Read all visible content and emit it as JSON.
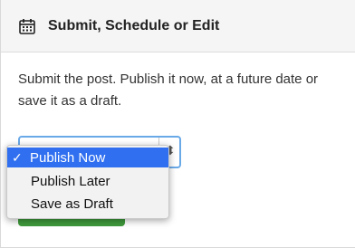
{
  "panel": {
    "title": "Submit, Schedule or Edit",
    "icon": "calendar-icon",
    "description": "Submit the post. Publish it now, at a future date or save it as a draft."
  },
  "publish_select": {
    "selected": "Publish Now",
    "options": [
      {
        "label": "Publish Now",
        "checkmark": "✓"
      },
      {
        "label": "Publish Later"
      },
      {
        "label": "Save as Draft"
      }
    ]
  },
  "colors": {
    "accent": "#2f6ff0",
    "focus_ring": "#6aa9e8",
    "button_green": "#3f9a3b",
    "header_bg": "#f5f5f5"
  }
}
